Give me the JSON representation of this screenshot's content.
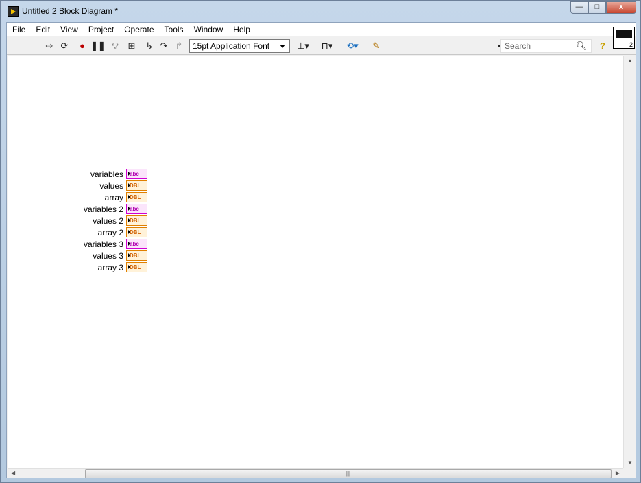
{
  "window": {
    "title": "Untitled 2 Block Diagram *",
    "min_label": "—",
    "max_label": "□",
    "close_label": "x"
  },
  "menu": [
    "File",
    "Edit",
    "View",
    "Project",
    "Operate",
    "Tools",
    "Window",
    "Help"
  ],
  "toolbar": {
    "font_select_value": "15pt Application Font",
    "search_placeholder": "Search",
    "icons": [
      "run-arrow",
      "run-continuous",
      "abort",
      "pause",
      "highlight-execution",
      "retain-wire-values",
      "step-into",
      "step-over",
      "step-out",
      "align",
      "distribute",
      "reorder",
      "cleanup",
      "search",
      "help"
    ]
  },
  "vi_icon": {
    "number": "2"
  },
  "terminals": [
    {
      "label": "variables",
      "type": "abc"
    },
    {
      "label": "values",
      "type": "DBL"
    },
    {
      "label": "array",
      "type": "DBL"
    },
    {
      "label": "variables 2",
      "type": "abc"
    },
    {
      "label": "values 2",
      "type": "DBL"
    },
    {
      "label": "array 2",
      "type": "DBL"
    },
    {
      "label": "variables 3",
      "type": "abc"
    },
    {
      "label": "values 3",
      "type": "DBL"
    },
    {
      "label": "array 3",
      "type": "DBL"
    }
  ],
  "colors": {
    "string_terminal": "#d000d0",
    "numeric_terminal": "#e08000"
  }
}
